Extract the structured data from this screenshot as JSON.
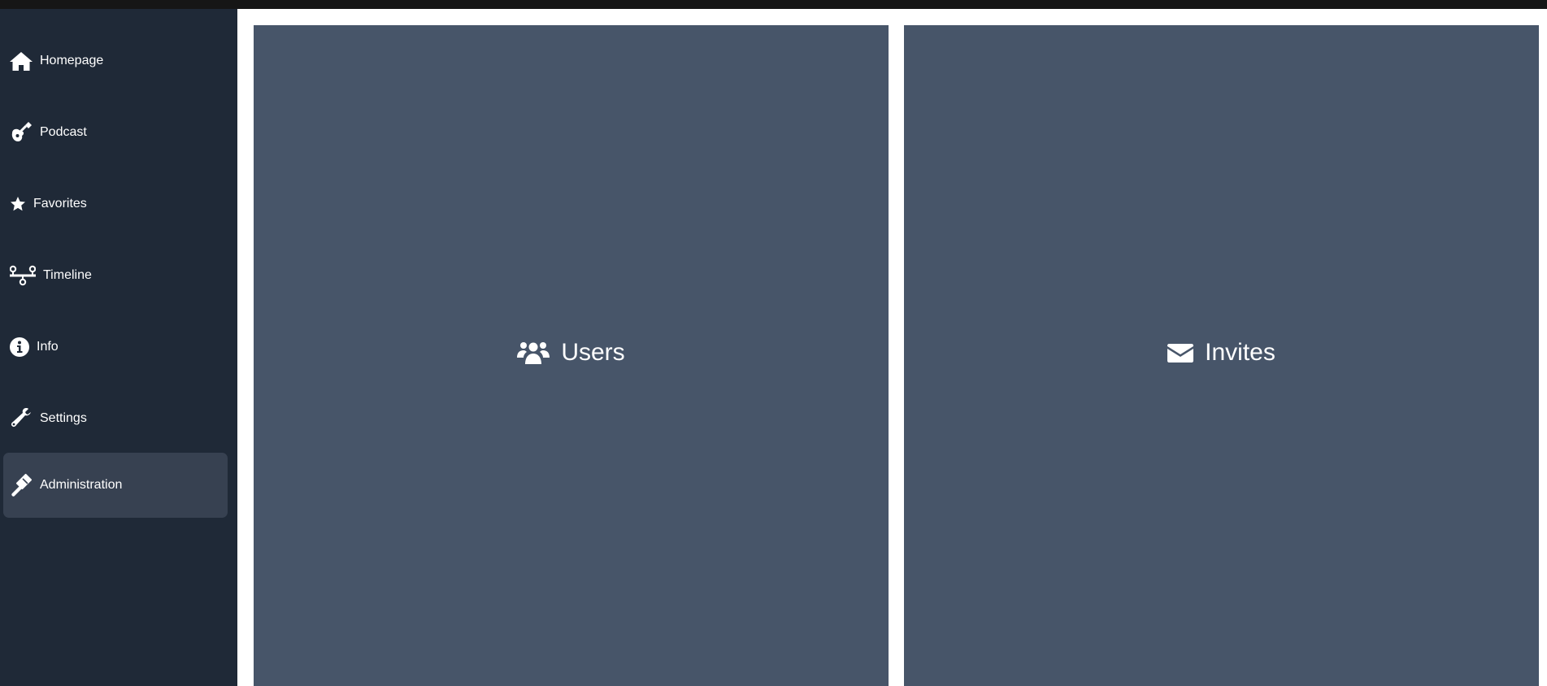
{
  "sidebar": {
    "items": [
      {
        "label": "Homepage",
        "icon": "home-icon"
      },
      {
        "label": "Podcast",
        "icon": "guitar-icon"
      },
      {
        "label": "Favorites",
        "icon": "star-icon"
      },
      {
        "label": "Timeline",
        "icon": "timeline-icon"
      },
      {
        "label": "Info",
        "icon": "info-icon"
      },
      {
        "label": "Settings",
        "icon": "wrench-icon"
      },
      {
        "label": "Administration",
        "icon": "gavel-icon",
        "active": true
      }
    ]
  },
  "main": {
    "cards": [
      {
        "label": "Users",
        "icon": "users-icon"
      },
      {
        "label": "Invites",
        "icon": "envelope-icon"
      }
    ]
  },
  "colors": {
    "sidebar_bg": "#1f2937",
    "active_item_bg": "#374151",
    "card_bg": "#475569",
    "topbar_bg": "#161616"
  }
}
